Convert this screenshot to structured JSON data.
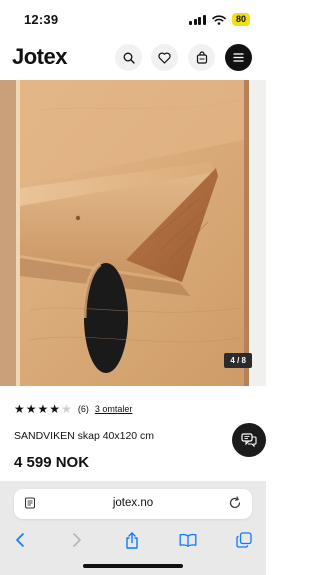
{
  "status": {
    "time": "12:39",
    "battery": "80"
  },
  "header": {
    "logo": "Jotex",
    "icons": [
      "search-icon",
      "heart-icon",
      "bag-icon",
      "menu-icon"
    ]
  },
  "gallery": {
    "counter": "4 / 8"
  },
  "product": {
    "rating": 4,
    "rating_max": 5,
    "review_count": "(6)",
    "reviews_link": "3 omtaler",
    "title": "SANDVIKEN skap 40x120 cm",
    "price": "4 599 NOK"
  },
  "browser": {
    "url": "jotex.no",
    "toolbar": [
      "back-icon",
      "forward-icon",
      "share-icon",
      "bookmarks-icon",
      "tabs-icon"
    ]
  },
  "colors": {
    "accent": "#111111",
    "star": "#111111",
    "star_empty": "#cfcfcf",
    "battery": "#f2de17",
    "toolbar_blue": "#0a7aff"
  }
}
